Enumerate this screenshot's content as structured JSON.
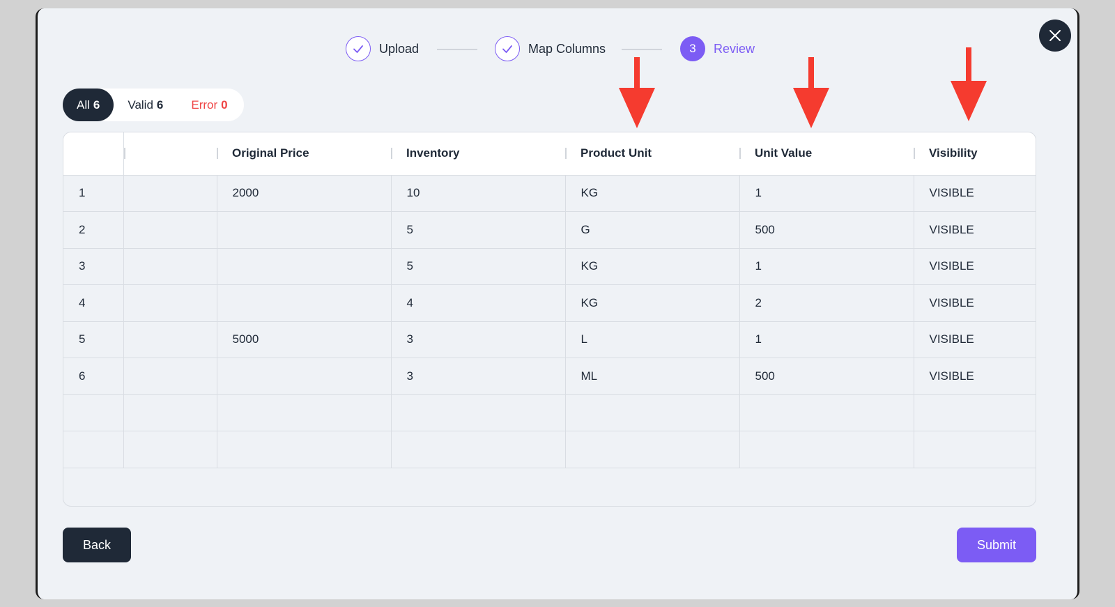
{
  "stepper": {
    "steps": [
      {
        "label": "Upload",
        "state": "done"
      },
      {
        "label": "Map Columns",
        "state": "done"
      },
      {
        "label": "Review",
        "number": "3",
        "state": "active"
      }
    ]
  },
  "filters": {
    "all": {
      "label": "All",
      "count": "6"
    },
    "valid": {
      "label": "Valid",
      "count": "6"
    },
    "error": {
      "label": "Error",
      "count": "0"
    }
  },
  "table": {
    "columns": [
      "",
      "",
      "Original Price",
      "Inventory",
      "Product Unit",
      "Unit Value",
      "Visibility"
    ],
    "rows": [
      [
        "1",
        "",
        "2000",
        "10",
        "KG",
        "1",
        "VISIBLE"
      ],
      [
        "2",
        "",
        "",
        "5",
        "G",
        "500",
        "VISIBLE"
      ],
      [
        "3",
        "",
        "",
        "5",
        "KG",
        "1",
        "VISIBLE"
      ],
      [
        "4",
        "",
        "",
        "4",
        "KG",
        "2",
        "VISIBLE"
      ],
      [
        "5",
        "",
        "5000",
        "3",
        "L",
        "1",
        "VISIBLE"
      ],
      [
        "6",
        "",
        "",
        "3",
        "ML",
        "500",
        "VISIBLE"
      ],
      [
        "",
        "",
        "",
        "",
        "",
        "",
        ""
      ],
      [
        "",
        "",
        "",
        "",
        "",
        "",
        ""
      ]
    ]
  },
  "buttons": {
    "back": "Back",
    "submit": "Submit"
  },
  "colors": {
    "accent": "#7c5cf4",
    "dark": "#1f2937",
    "error": "#ef4444",
    "annotation_arrow": "#f53b2f"
  },
  "icons": {
    "close": "close-icon",
    "check": "check-icon",
    "annotation": "arrow-down-icon"
  }
}
